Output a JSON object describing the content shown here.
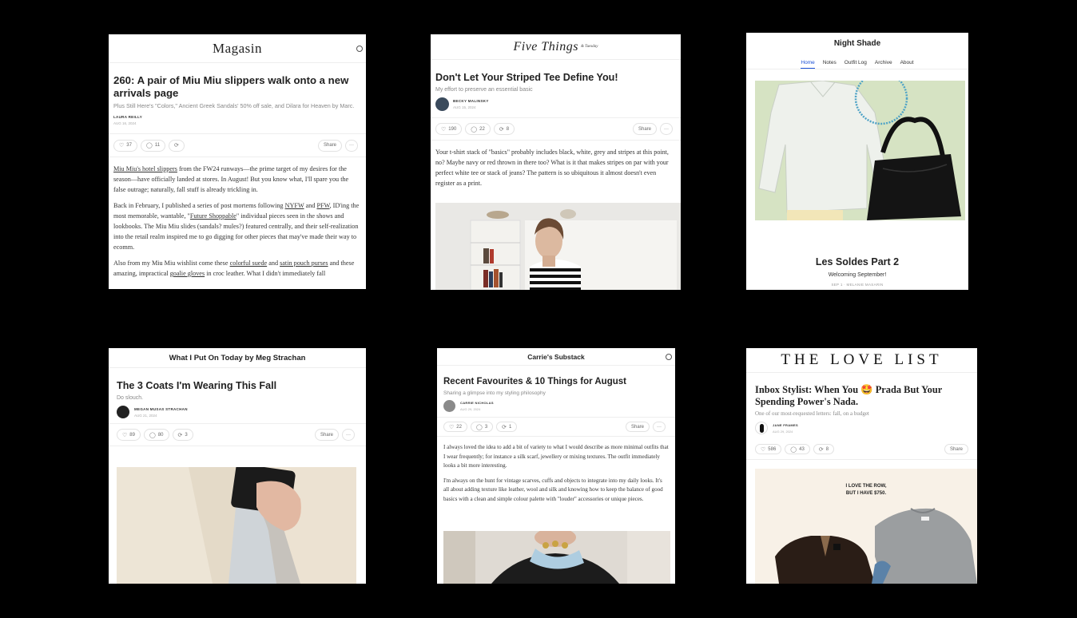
{
  "cards": [
    {
      "brand": "Magasin",
      "title": "260: A pair of Miu Miu slippers walk onto a new arrivals page",
      "subtitle": "Plus Still Here's \"Colors,\" Ancient Greek Sandals' 50% off sale, and Dilara for Heaven by Marc.",
      "author": "LAURA REILLY",
      "date": "AUG 16, 2024",
      "likes": "37",
      "comments": "11",
      "share": "Share",
      "more": "···",
      "p1_link": "Miu Miu's hotel slippers",
      "p1_rest": " from the FW24 runways—the prime target of my desires for the season—have officially landed at stores. In August! But you know what, I'll spare you the false outrage; naturally, fall stuff is already trickling in.",
      "p2_a": "Back in February, I published a series of post mortems following ",
      "p2_nyfw": "NYFW",
      "p2_b": " and ",
      "p2_pfw": "PFW",
      "p2_c": ", ID'ing the most memorable, wantable, \"",
      "p2_fs": "Future Shoppable",
      "p2_d": "\" individual pieces seen in the shows and lookbooks. The Miu Miu slides (sandals? mules?) featured centrally, and their self-realization into the retail realm inspired me to go digging for other pieces that may've made their way to ecomm.",
      "p3_a": "Also from my Miu Miu wishlist come these ",
      "p3_suede": "colorful suede",
      "p3_b": " and ",
      "p3_satin": "satin pouch purses",
      "p3_c": " and these amazing, impractical ",
      "p3_goalie": "goalie gloves",
      "p3_d": " in croc leather. What I didn't immediately fall"
    },
    {
      "brand": "Five Things",
      "brand_sub": "& Tuesday",
      "title": "Don't Let Your Striped Tee Define You!",
      "subtitle": "My effort to preserve an essential basic",
      "author": "BECKY MALINSKY",
      "date": "AUG 15, 2024",
      "likes": "190",
      "comments": "22",
      "restacks": "8",
      "share": "Share",
      "more": "···",
      "body": "Your t-shirt stack of \"basics\" probably includes black, white, grey and stripes at this point, no? Maybe navy or red thrown in there too? What is it that makes stripes on par with your perfect white tee or stack of jeans? The pattern is so ubiquitous it almost doesn't even register as a print."
    },
    {
      "brand": "Night Shade",
      "nav": [
        "Home",
        "Notes",
        "Outfit Log",
        "Archive",
        "About"
      ],
      "title": "Les Soldes Part 2",
      "subtitle": "Welcoming September!",
      "meta": "SEP 1 · MELANIE MASARIN"
    },
    {
      "brand": "What I Put On Today by Meg Strachan",
      "title": "The 3 Coats I'm Wearing This Fall",
      "subtitle": "Do slouch.",
      "author": "MEGAN MUSAS STRACHAN",
      "date": "AUG 21, 2024",
      "likes": "89",
      "comments": "80",
      "restacks": "3",
      "share": "Share",
      "more": "···"
    },
    {
      "brand": "Carrie's Substack",
      "title": "Recent Favourites & 10 Things for August",
      "subtitle": "Sharing a glimpse into my styling philosophy",
      "author": "CARRIE NICHOLAS",
      "date": "AUG 29, 2024",
      "likes": "22",
      "comments": "3",
      "restacks": "1",
      "share": "Share",
      "more": "···",
      "p1": "I always loved the idea to add a bit of variety to what I would describe as more minimal outfits that I wear frequently; for instance a silk scarf, jewellery or mixing textures. The outfit immediately looks a bit more interesting.",
      "p2": "I'm always on the hunt for vintage scarves, cuffs and objects to integrate into my daily looks. It's all about adding texture like leather, wool and silk and knowing how to keep the balance of good basics with a clean and simple colour palette with \"louder\" accessories or unique pieces."
    },
    {
      "brand": "THE LOVE LIST",
      "title": "Inbox Stylist: When You 🤩 Prada But Your Spending Power's Nada.",
      "subtitle": "One of our most-requested letters: fall, on a budget",
      "author": "JANE FRAMES",
      "date": "AUG 29, 2024",
      "likes": "586",
      "comments": "43",
      "restacks": "8",
      "share": "Share",
      "caption_1": "I LOVE THE ROW,",
      "caption_2": "BUT I HAVE $750."
    }
  ],
  "colors": {
    "background": "#000000",
    "nav_active": "#1a4fd6",
    "nightshade_photo_bg": "#d6e3c3",
    "lovelist_photo_bg": "#f8f1e7"
  }
}
